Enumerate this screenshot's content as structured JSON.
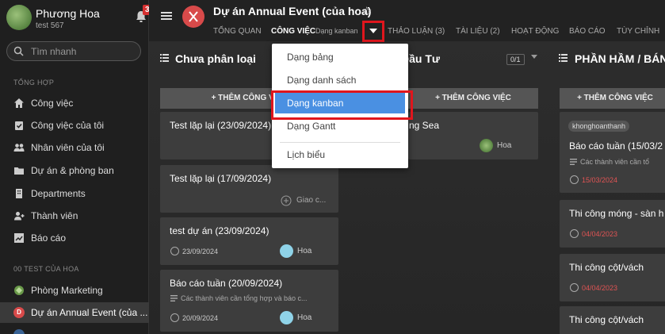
{
  "user": {
    "name": "Phương Hoa",
    "sub": "test 567",
    "notif_count": "3"
  },
  "search": {
    "placeholder": "Tìm nhanh"
  },
  "sections": {
    "general": "TỔNG HỢP",
    "org": "00 TEST CỦA HOA"
  },
  "nav": [
    {
      "label": "Công việc"
    },
    {
      "label": "Công việc của tôi"
    },
    {
      "label": "Nhân viên của tôi"
    },
    {
      "label": "Dự án & phòng ban"
    },
    {
      "label": "Departments"
    },
    {
      "label": "Thành viên"
    },
    {
      "label": "Báo cáo"
    }
  ],
  "org_items": [
    {
      "label": "Phòng Marketing"
    },
    {
      "label": "Dự án Annual Event (của ...",
      "badge": "D"
    }
  ],
  "header": {
    "title": "Dự án Annual Event (của hoa)",
    "tabs": [
      "TỔNG QUAN",
      "CÔNG VIỆC",
      "THẢO LUẬN (3)",
      "TÀI LIỆU (2)",
      "HOẠT ĐỘNG",
      "BÁO CÁO",
      "TÙY CHỈNH"
    ],
    "view_sub": "Dạng kanban"
  },
  "columns": [
    {
      "title": "Chưa phân loại",
      "add": "+ THÊM CÔNG VIỆC"
    },
    {
      "title": "Đầu Tư",
      "add": "+ THÊM CÔNG VIỆC",
      "count": "0/1"
    },
    {
      "title": "PHẦN HẦM / BÁN",
      "add": "+ THÊM CÔNG VIỆC"
    }
  ],
  "cards_col1": [
    {
      "title": "Test lặp lại (23/09/2024)"
    },
    {
      "title": "Test lặp lại (17/09/2024)",
      "assign": "Giao c..."
    },
    {
      "title": "test dự án (23/09/2024)",
      "date": "23/09/2024",
      "person": "Hoa"
    },
    {
      "title": "Báo cáo tuần (20/09/2024)",
      "desc": "Các thành viên cần tổng hợp và báo c...",
      "date": "20/09/2024",
      "person": "Hoa"
    }
  ],
  "cards_col2": [
    {
      "title": "ng Sea",
      "person": "Hoa"
    }
  ],
  "cards_col3": [
    {
      "tag": "khonghoanthanh",
      "title": "Báo cáo tuần (15/03/2",
      "desc": "Các thành viên cần tổ",
      "date": "15/03/2024"
    },
    {
      "title": "Thi công móng - sàn h",
      "date": "04/04/2023"
    },
    {
      "title": "Thi công cột/vách",
      "date": "04/04/2023"
    },
    {
      "title": "Thi công cột/vách"
    }
  ],
  "menu": [
    "Dạng bảng",
    "Dạng danh sách",
    "Dạng kanban",
    "Dạng Gantt",
    "Lịch biểu"
  ],
  "colors": {
    "accent": "#4a90e2",
    "highlight": "#e0161d",
    "danger": "#e05454"
  }
}
